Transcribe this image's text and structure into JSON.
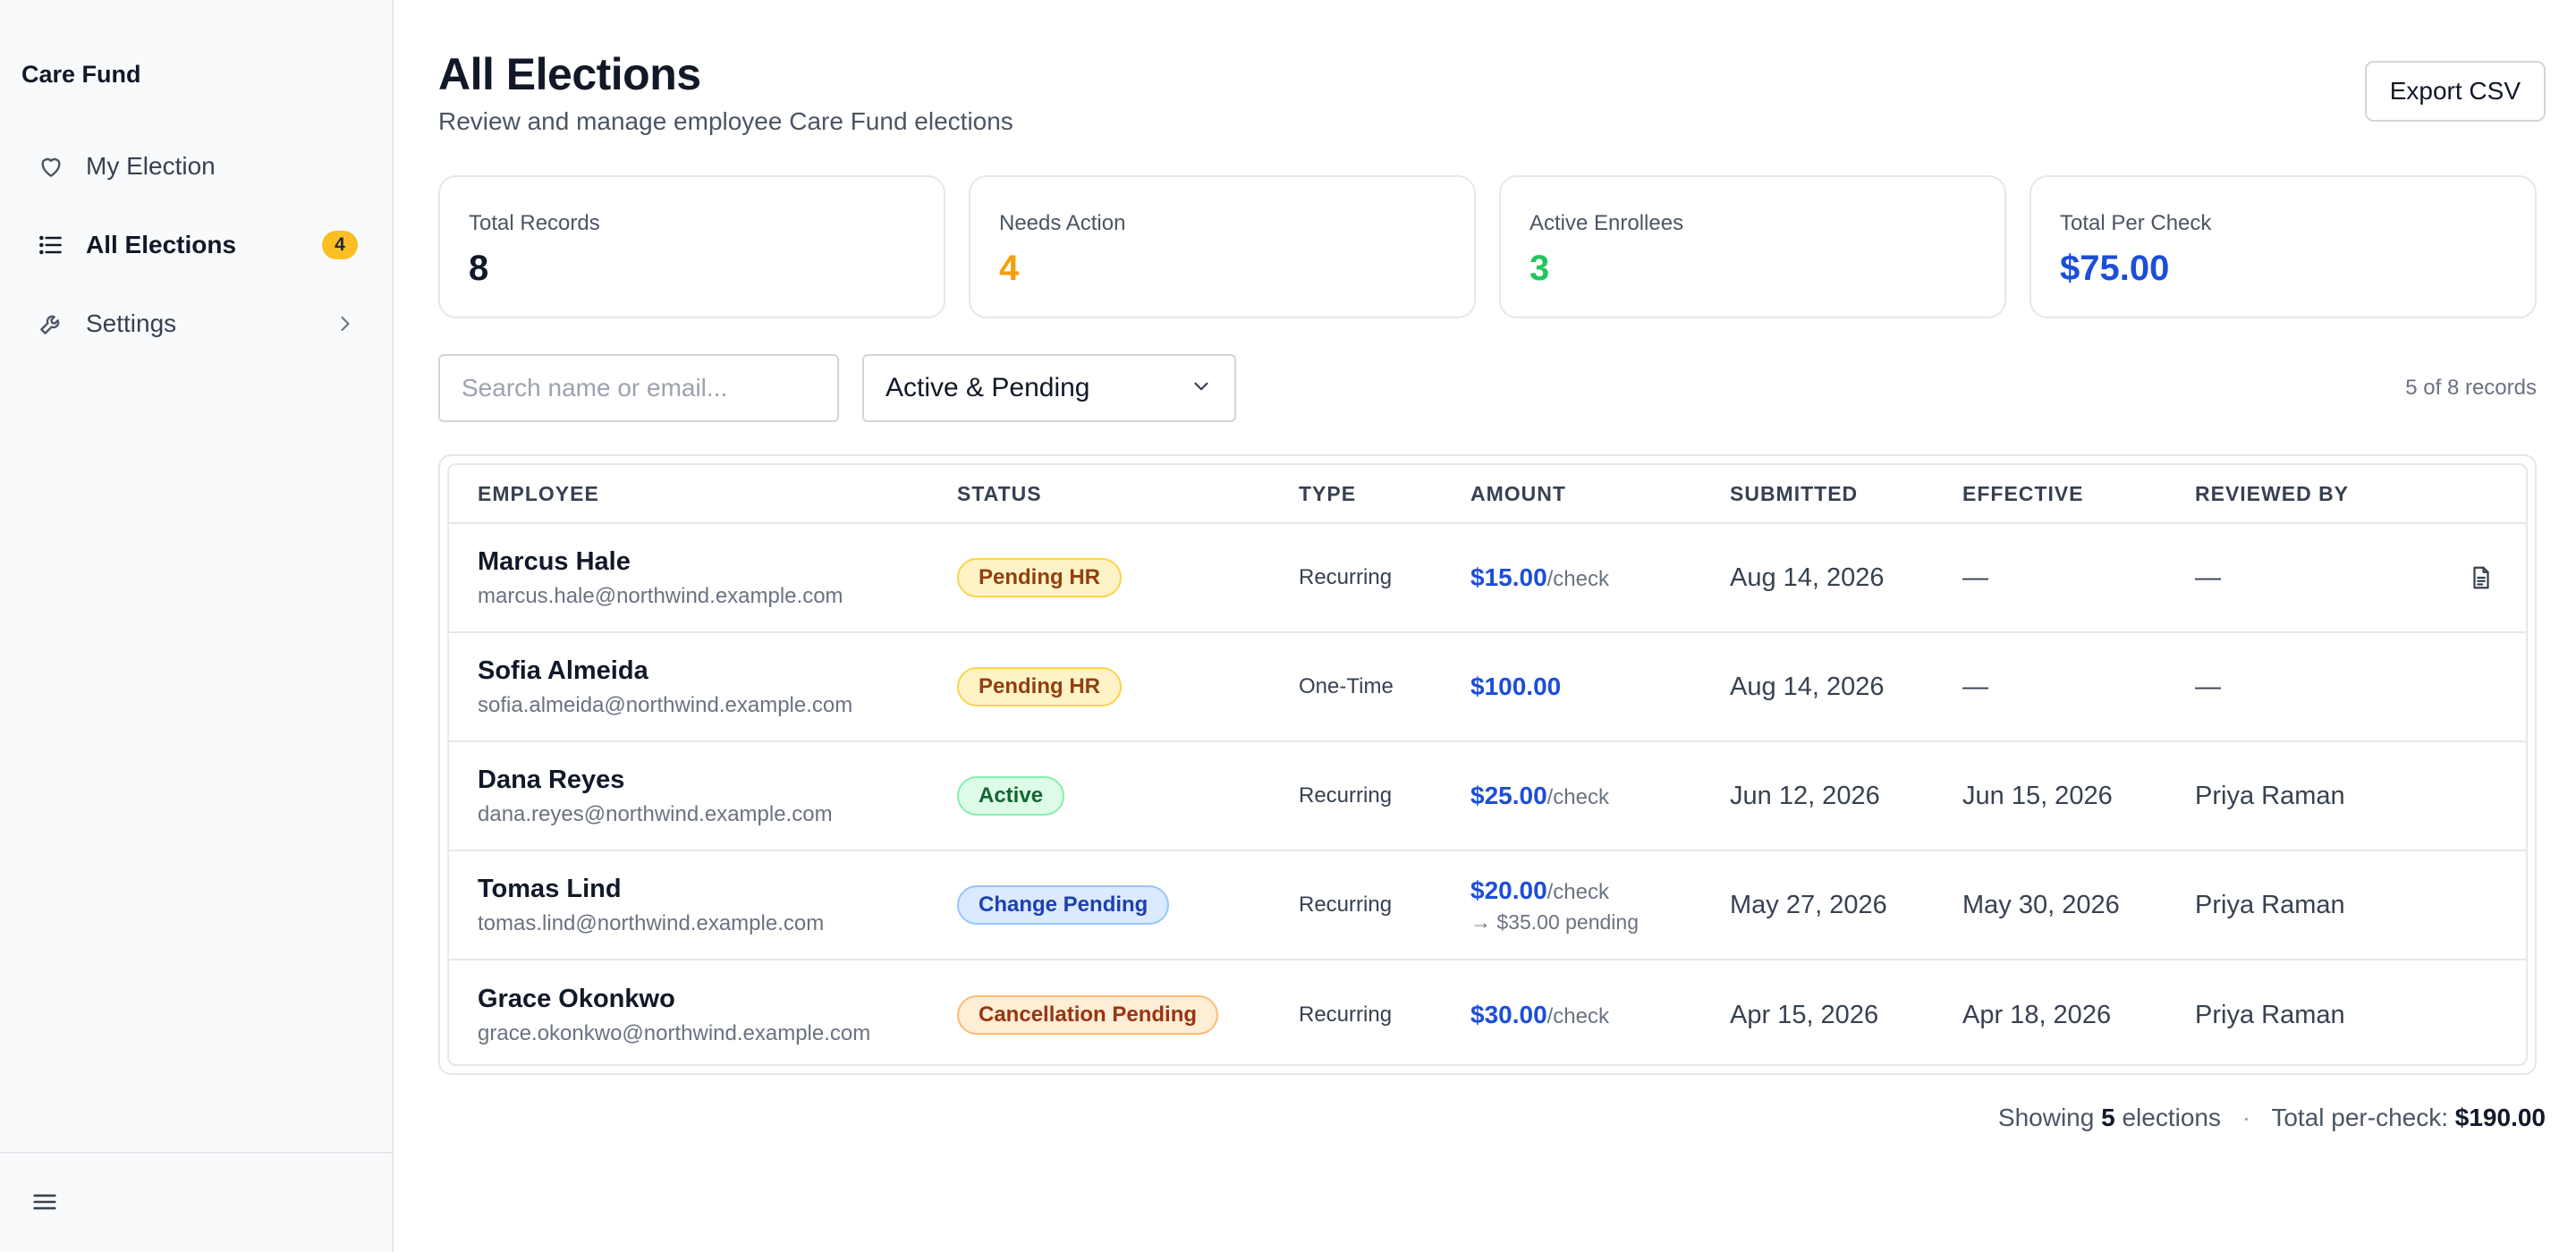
{
  "sidebar": {
    "brand": "Care Fund",
    "items": [
      {
        "label": "My Election",
        "icon": "heart-icon"
      },
      {
        "label": "All Elections",
        "icon": "list-icon",
        "badge": "4"
      },
      {
        "label": "Settings",
        "icon": "wrench-icon"
      }
    ]
  },
  "header": {
    "title": "All Elections",
    "subtitle": "Review and manage employee Care Fund elections",
    "export_label": "Export CSV"
  },
  "stats": [
    {
      "label": "Total Records",
      "value": "8",
      "color": "#111827"
    },
    {
      "label": "Needs Action",
      "value": "4",
      "color": "#f59e0b"
    },
    {
      "label": "Active Enrollees",
      "value": "3",
      "color": "#22c55e"
    },
    {
      "label": "Total Per Check",
      "value": "$75.00",
      "color": "#1d4ed8"
    }
  ],
  "toolbar": {
    "search_placeholder": "Search name or email...",
    "filter_value": "Active & Pending",
    "record_count": "5 of 8 records"
  },
  "table": {
    "headers": [
      "EMPLOYEE",
      "STATUS",
      "TYPE",
      "AMOUNT",
      "SUBMITTED",
      "EFFECTIVE",
      "REVIEWED BY"
    ],
    "rows": [
      {
        "name": "Marcus Hale",
        "email": "marcus.hale@northwind.example.com",
        "status": "Pending HR",
        "type": "Recurring",
        "amount": "$15.00",
        "unit": "/check",
        "submitted": "Aug 14, 2026",
        "effective": "—",
        "reviewed_by": "—",
        "has_doc": true
      },
      {
        "name": "Sofia Almeida",
        "email": "sofia.almeida@northwind.example.com",
        "status": "Pending HR",
        "type": "One-Time",
        "amount": "$100.00",
        "unit": "",
        "submitted": "Aug 14, 2026",
        "effective": "—",
        "reviewed_by": "—"
      },
      {
        "name": "Dana Reyes",
        "email": "dana.reyes@northwind.example.com",
        "status": "Active",
        "type": "Recurring",
        "amount": "$25.00",
        "unit": "/check",
        "submitted": "Jun 12, 2026",
        "effective": "Jun 15, 2026",
        "reviewed_by": "Priya Raman"
      },
      {
        "name": "Tomas Lind",
        "email": "tomas.lind@northwind.example.com",
        "status": "Change Pending",
        "type": "Recurring",
        "amount": "$20.00",
        "unit": "/check",
        "amount_sub": "→ $35.00 pending",
        "submitted": "May 27, 2026",
        "effective": "May 30, 2026",
        "reviewed_by": "Priya Raman"
      },
      {
        "name": "Grace Okonkwo",
        "email": "grace.okonkwo@northwind.example.com",
        "status": "Cancellation Pending",
        "type": "Recurring",
        "amount": "$30.00",
        "unit": "/check",
        "submitted": "Apr 15, 2026",
        "effective": "Apr 18, 2026",
        "reviewed_by": "Priya Raman"
      }
    ]
  },
  "footer": {
    "showing_prefix": "Showing",
    "showing_count": "5",
    "showing_suffix": "elections",
    "separator": "·",
    "total_label": "Total per-check:",
    "total_value": "$190.00"
  }
}
